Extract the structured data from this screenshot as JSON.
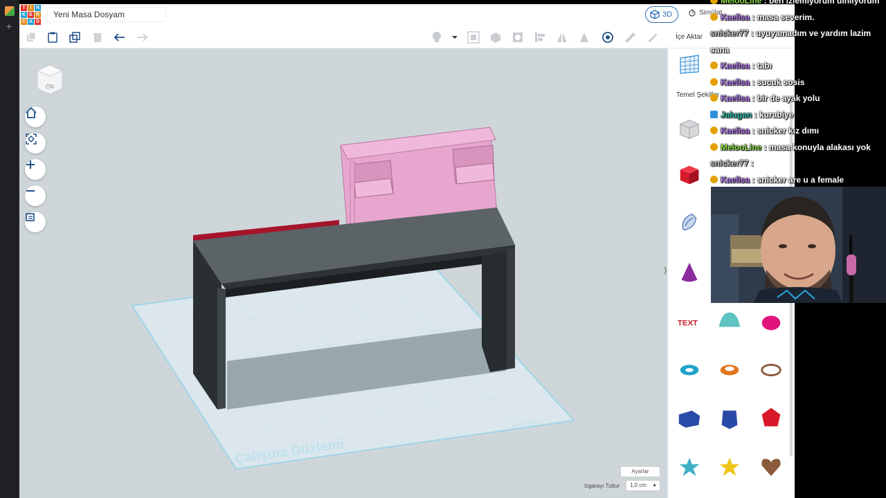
{
  "app": {
    "logo_letters": [
      "T",
      "I",
      "N",
      "K",
      "E",
      "R",
      "C",
      "A",
      "D"
    ],
    "logo_colors": [
      "#e2352a",
      "#e38b1e",
      "#21a0d6",
      "#21a0d6",
      "#e2352a",
      "#e38b1e",
      "#e38b1e",
      "#21a0d6",
      "#e2352a"
    ],
    "project_name": "Yeni Masa Dosyam",
    "view_3d_label": "3D",
    "simulate_label": "Simülat",
    "import_label": "İçe Aktar",
    "shapes_category_label": "Temel Şekiller",
    "settings_label": "Ayarlar",
    "snap_grid_label": "Izgarayı Tuttur",
    "snap_grid_value": "1,0 cm"
  },
  "viewport": {
    "view_cube_label": "ÖN",
    "workplane_label": "Çalışma Düzlemi",
    "units_label": "Centimeters",
    "nav_buttons": [
      "home-view",
      "fit-view",
      "zoom-in",
      "zoom-out",
      "perspective-toggle"
    ]
  },
  "shapes": [
    {
      "name": "box-hole",
      "color": "#b0b4b8"
    },
    {
      "name": "box",
      "color": "#d41a2b"
    },
    {
      "name": "scribble",
      "color": "#5b7fbf"
    },
    {
      "name": "cone",
      "color": "#8b2a9f"
    },
    {
      "name": "text",
      "color": "#c41f2b"
    },
    {
      "name": "half-sphere",
      "color": "#5ec3c1"
    },
    {
      "name": "paraboloid",
      "color": "#e0147c"
    },
    {
      "name": "torus",
      "color": "#1fa3c9"
    },
    {
      "name": "tube",
      "color": "#e0761d"
    },
    {
      "name": "ring",
      "color": "#8a5a3a"
    },
    {
      "name": "wedge-box",
      "color": "#2a4aa8"
    },
    {
      "name": "hexagonal-prism",
      "color": "#2a4aa8"
    },
    {
      "name": "polyhedron",
      "color": "#d8192c"
    },
    {
      "name": "star",
      "color": "#3fb0c4"
    },
    {
      "name": "star-yellow",
      "color": "#f0c419"
    },
    {
      "name": "heart",
      "color": "#8a5a3a"
    }
  ],
  "chat": [
    {
      "user": "MelooLine",
      "user_color": "#8fe04a",
      "text": ": ben izlemiyorum dinliyorum",
      "badge": "gold"
    },
    {
      "user": "Kaelisa",
      "user_color": "#b67cf0",
      "text": ": masa severim.",
      "badge": "gold"
    },
    {
      "user": "snicker77",
      "user_color": "#c9c9c9",
      "text": ": uyuyamadım ve yardım lazim",
      "badge": "none"
    },
    {
      "user": "",
      "user_color": "#ffffff",
      "text": "sana",
      "badge": "none"
    },
    {
      "user": "Kaelisa",
      "user_color": "#b67cf0",
      "text": ": tabı",
      "badge": "gold"
    },
    {
      "user": "Kaelisa",
      "user_color": "#b67cf0",
      "text": ": sucuk sosis",
      "badge": "gold"
    },
    {
      "user": "Kaelisa",
      "user_color": "#b67cf0",
      "text": ": bir de ayak yolu",
      "badge": "gold"
    },
    {
      "user": "Jalugan",
      "user_color": "#2fbfa9",
      "text": ": kurabiye",
      "badge": "blue"
    },
    {
      "user": "Kaelisa",
      "user_color": "#b67cf0",
      "text": ": snicker kız dımı",
      "badge": "gold"
    },
    {
      "user": "MelooLine",
      "user_color": "#8fe04a",
      "text": ": masa konuyla alakası yok",
      "badge": "gold"
    },
    {
      "user": "snicker77",
      "user_color": "#c9c9c9",
      "text": ":",
      "badge": "none"
    },
    {
      "user": "Kaelisa",
      "user_color": "#b67cf0",
      "text": ": snicker are u a female",
      "badge": "gold"
    }
  ]
}
